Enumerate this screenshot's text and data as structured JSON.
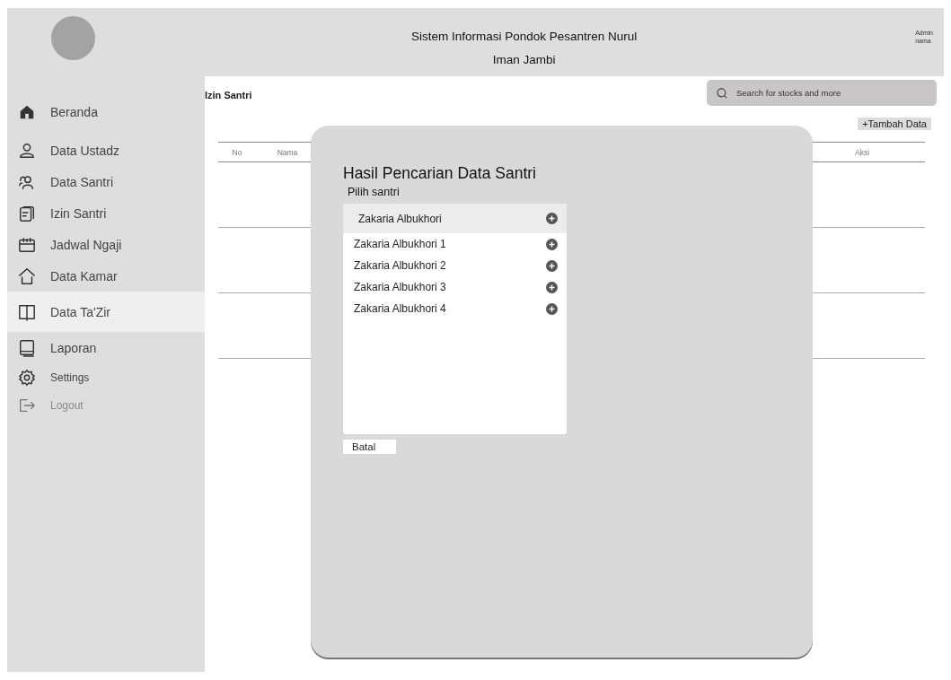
{
  "header": {
    "title_lines": [
      "Sistem Informasi Pondok Pesantren Nurul",
      "Iman Jambi"
    ],
    "user_lines": [
      "Admin",
      "nama"
    ]
  },
  "sidebar": {
    "items": [
      {
        "label": "Beranda",
        "selected": false,
        "disabled": false
      },
      {
        "label": "Data Ustadz",
        "selected": false,
        "disabled": false
      },
      {
        "label": "Data Santri",
        "selected": false,
        "disabled": false
      },
      {
        "label": "Izin Santri",
        "selected": false,
        "disabled": false
      },
      {
        "label": "Jadwal Ngaji",
        "selected": false,
        "disabled": false
      },
      {
        "label": "Data Kamar",
        "selected": false,
        "disabled": false
      },
      {
        "label": "Data Ta'Zir",
        "selected": true,
        "disabled": false
      },
      {
        "label": "Laporan",
        "selected": false,
        "disabled": false
      },
      {
        "label": "Settings",
        "selected": false,
        "disabled": false
      },
      {
        "label": "Logout",
        "selected": false,
        "disabled": true
      }
    ]
  },
  "page_title": "Izin Santri",
  "search": {
    "placeholder": "Search for stocks and more"
  },
  "add_button": "+Tambah Data",
  "table": {
    "columns": [
      "No",
      "Nama",
      "Aksi"
    ]
  },
  "modal": {
    "title": "Hasil Pencarian Data Santri",
    "subtitle": "Pilih santri",
    "items": [
      {
        "label": "Zakaria Albukhori",
        "selected": true
      },
      {
        "label": "Zakaria Albukhori 1",
        "selected": false
      },
      {
        "label": "Zakaria Albukhori 2",
        "selected": false
      },
      {
        "label": "Zakaria Albukhori 3",
        "selected": false
      },
      {
        "label": "Zakaria Albukhori 4",
        "selected": false
      }
    ],
    "cancel_button": "Batal"
  }
}
